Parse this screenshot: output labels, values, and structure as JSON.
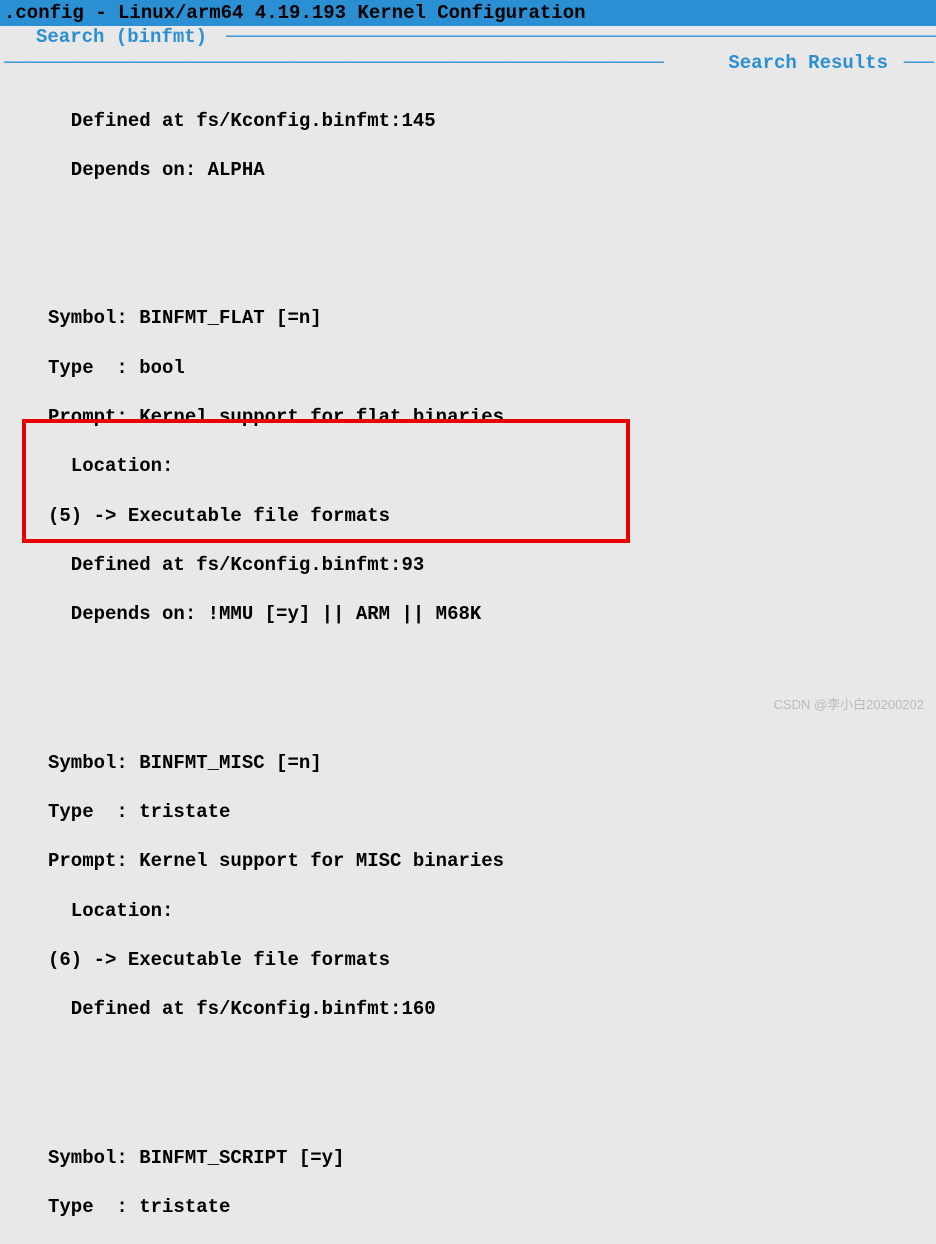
{
  "titlebar": {
    "title": ".config - Linux/arm64 4.19.193 Kernel Configuration"
  },
  "subtitle": {
    "text": "Search (binfmt)",
    "dashes": "─────────────────────────────────────────────────────────────────────────────────────"
  },
  "results": {
    "dashes_left": "─────────────────────────────────────────────────────────────────────────────────────",
    "label": "Search Results",
    "dashes_right": "───"
  },
  "lines": {
    "l1": "  Defined at fs/Kconfig.binfmt:145",
    "l2": "  Depends on: ALPHA",
    "l3": "",
    "l4": "",
    "l5": "Symbol: BINFMT_FLAT [=n]",
    "l6": "Type  : bool",
    "l7": "Prompt: Kernel support for flat binaries",
    "l8": "  Location:",
    "l9": "(5) -> Executable file formats",
    "l10": "  Defined at fs/Kconfig.binfmt:93",
    "l11": "  Depends on: !MMU [=y] || ARM || M68K",
    "l12": "",
    "l13": "",
    "l14": "Symbol: BINFMT_MISC [=n]",
    "l15": "Type  : tristate",
    "l16": "Prompt: Kernel support for MISC binaries",
    "l17": "  Location:",
    "l18": "(6) -> Executable file formats",
    "l19": "  Defined at fs/Kconfig.binfmt:160",
    "l20": "",
    "l21": "",
    "l22": "Symbol: BINFMT_SCRIPT [=y]",
    "l23": "Type  : tristate"
  },
  "watermark": "CSDN @李小白20200202"
}
